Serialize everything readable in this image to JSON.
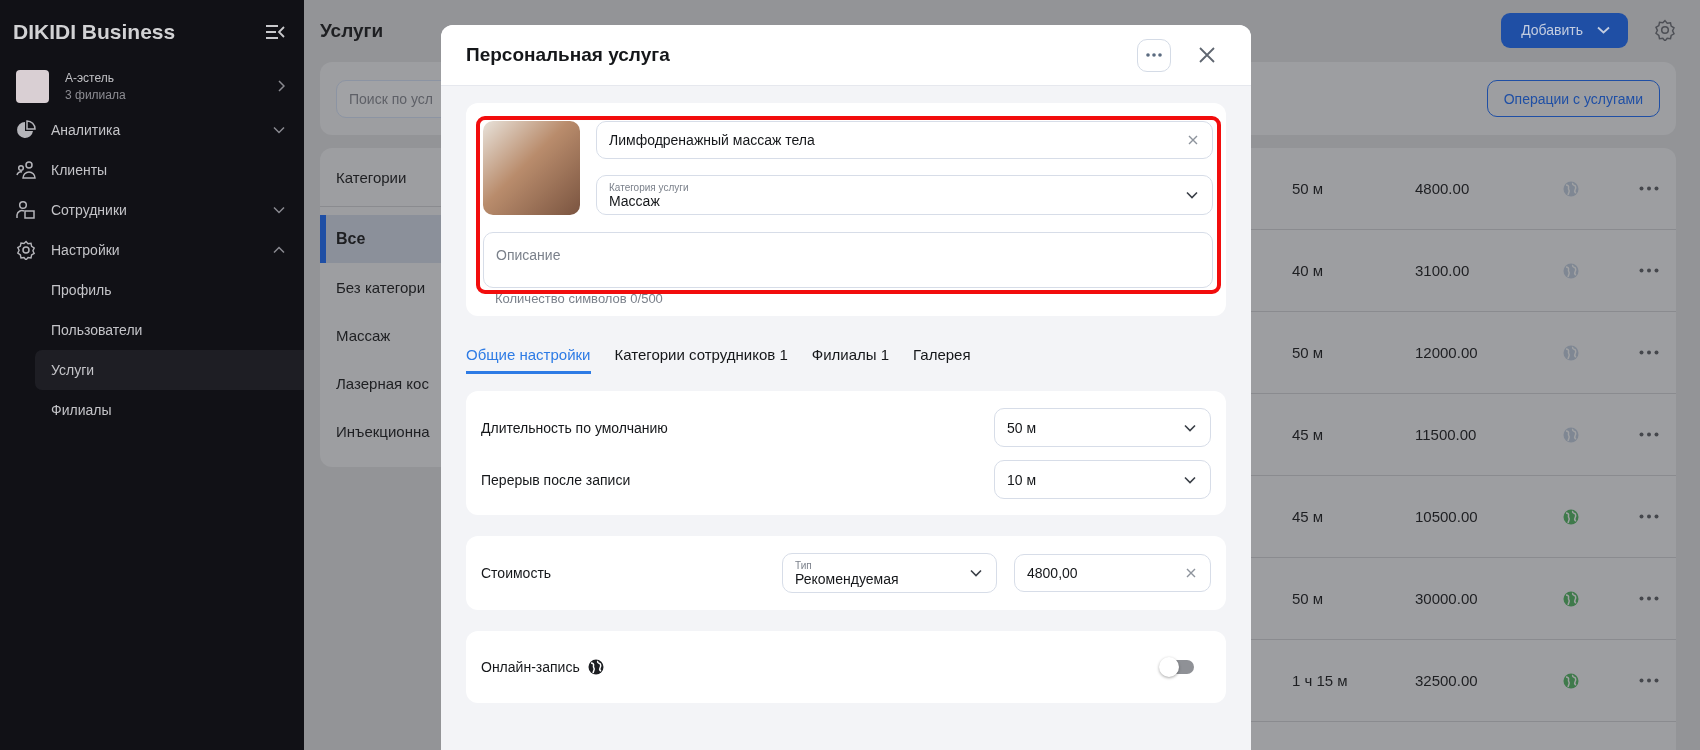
{
  "sidebar": {
    "brand": "DIKIDI Business",
    "org": {
      "name": "А-эстель",
      "subtitle": "3 филиала"
    },
    "items": [
      {
        "kind": "pie",
        "label": "Аналитика",
        "has_children": true,
        "expanded": false
      },
      {
        "kind": "clients",
        "label": "Клиенты",
        "has_children": false
      },
      {
        "kind": "staff",
        "label": "Сотрудники",
        "has_children": true,
        "expanded": false
      },
      {
        "kind": "gear",
        "label": "Настройки",
        "has_children": true,
        "expanded": true,
        "children": [
          {
            "label": "Профиль",
            "selected": false
          },
          {
            "label": "Пользователи",
            "selected": false
          },
          {
            "label": "Услуги",
            "selected": true
          },
          {
            "label": "Филиалы",
            "selected": false
          }
        ]
      }
    ]
  },
  "page": {
    "title": "Услуги",
    "add_button": "Добавить",
    "search": {
      "placeholder": "Поиск по усл"
    },
    "operations_button": "Операции с услугами",
    "categories": {
      "header": "Категории",
      "items": [
        {
          "label": "Все",
          "selected": true
        },
        {
          "label": "Без категори",
          "selected": false
        },
        {
          "label": "Массаж",
          "selected": false
        },
        {
          "label": "Лазерная кос",
          "selected": false
        },
        {
          "label": "Инъекционна",
          "selected": false
        }
      ]
    },
    "table": {
      "rows": [
        {
          "duration": "50 м",
          "price": "4800.00",
          "online": false
        },
        {
          "duration": "40 м",
          "price": "3100.00",
          "online": false
        },
        {
          "duration": "50 м",
          "price": "12000.00",
          "online": false
        },
        {
          "duration": "45 м",
          "price": "11500.00",
          "online": false
        },
        {
          "duration": "45 м",
          "price": "10500.00",
          "online": true
        },
        {
          "duration": "50 м",
          "price": "30000.00",
          "online": true
        },
        {
          "duration": "1 ч 15 м",
          "price": "32500.00",
          "online": true
        }
      ]
    }
  },
  "modal": {
    "title": "Персональная услуга",
    "name_field": {
      "value": "Лимфодренажный массаж тела"
    },
    "category_field": {
      "label": "Категория услуги",
      "value": "Массаж"
    },
    "description": {
      "placeholder": "Описание"
    },
    "char_count": "Количество символов 0/500",
    "tabs": [
      {
        "label": "Общие настройки",
        "selected": true
      },
      {
        "label": "Категории сотрудников 1",
        "selected": false
      },
      {
        "label": "Филиалы 1",
        "selected": false
      },
      {
        "label": "Галерея",
        "selected": false
      }
    ],
    "settings": [
      {
        "label": "Длительность по умолчанию",
        "value": "50 м"
      },
      {
        "label": "Перерыв после записи",
        "value": "10 м"
      }
    ],
    "cost": {
      "label": "Стоимость",
      "type_label": "Тип",
      "type_value": "Рекомендуемая",
      "price": "4800,00"
    },
    "online_booking": {
      "label": "Онлайн-запись",
      "on": false
    }
  }
}
